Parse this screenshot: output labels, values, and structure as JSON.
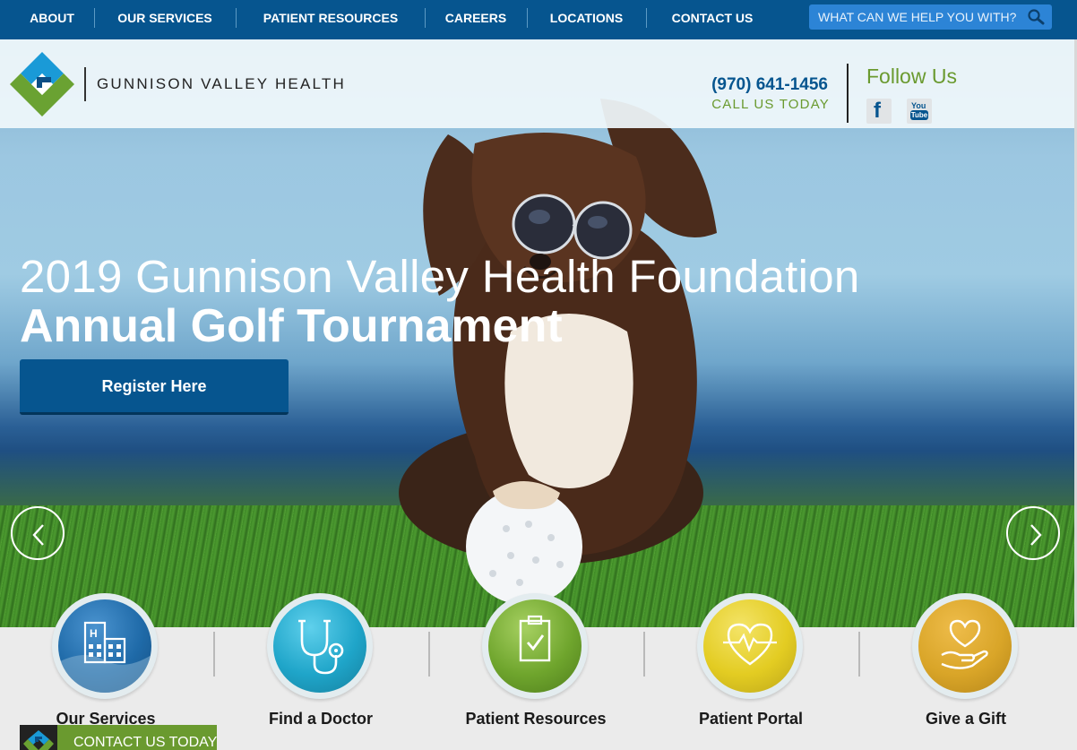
{
  "topnav": {
    "items": [
      {
        "label": "ABOUT"
      },
      {
        "label": "OUR SERVICES"
      },
      {
        "label": "PATIENT RESOURCES"
      },
      {
        "label": "CAREERS"
      },
      {
        "label": "LOCATIONS"
      },
      {
        "label": "CONTACT US"
      }
    ],
    "search": {
      "placeholder": "WHAT CAN WE HELP YOU WITH?",
      "icon": "search-icon"
    }
  },
  "header": {
    "brand": "GUNNISON VALLEY HEALTH",
    "phone": "(970) 641-1456",
    "call_today": "CALL US TODAY",
    "follow_us": "Follow Us",
    "social": [
      {
        "icon": "facebook-icon",
        "glyph": "f"
      },
      {
        "icon": "youtube-icon",
        "glyph_top": "You",
        "glyph_bottom": "Tube"
      }
    ]
  },
  "hero": {
    "title_light": "2019 Gunnison Valley Health Foundation",
    "title_bold": "Annual Golf Tournament",
    "button": "Register Here",
    "prev_icon": "chevron-left-icon",
    "next_icon": "chevron-right-icon"
  },
  "quick_links": [
    {
      "label": "Our Services",
      "icon": "hospital-building-icon",
      "color": "#1f6aa8"
    },
    {
      "label": "Find a Doctor",
      "icon": "stethoscope-icon",
      "color": "#1fa5c9"
    },
    {
      "label": "Patient Resources",
      "icon": "clipboard-check-icon",
      "color": "#6fa52d"
    },
    {
      "label": "Patient Portal",
      "icon": "heart-pulse-icon",
      "color": "#e3cc22"
    },
    {
      "label": "Give a Gift",
      "icon": "heart-hand-icon",
      "color": "#d9a528"
    }
  ],
  "contact_sticky": {
    "label": "CONTACT US TODAY"
  },
  "colors": {
    "primary_blue": "#06558f",
    "accent_green": "#6a9a2f"
  }
}
